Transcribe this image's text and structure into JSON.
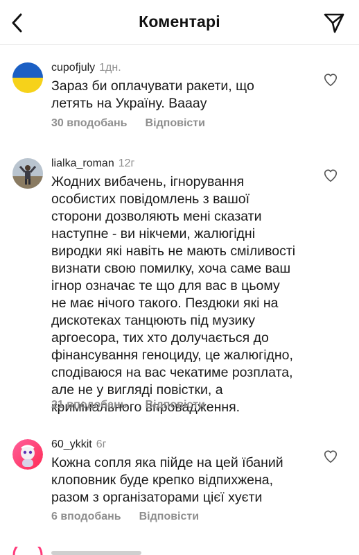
{
  "header": {
    "title": "Коментарі",
    "back_icon": "chevron-left-icon",
    "share_icon": "paper-plane-icon"
  },
  "comments": [
    {
      "username": "cupofjuly",
      "time": "1дн.",
      "text": "Зараз би оплачувати ракети, що\nлетять на Україну. Ваааy",
      "likes": "30 вподобань",
      "reply": "Відповісти",
      "avatar": "ukraine-flag-avatar",
      "colors": {
        "top": "#1b5fc4",
        "bottom": "#f6d21a"
      }
    },
    {
      "username": "lialka_roman",
      "time": "12г",
      "text": "Жодних вибачень, ігнорування\nособистих повідомлень з вашої\nсторони дозволяють мені сказати\nнаступне - ви нікчеми, жалюгідні\nвиродки які навіть не мають сміливості\nвизнати свою помилку, хоча саме ваш\nігнор означає те що для вас в цьому\nне має нічого такого. Пездюки які на\nдискотеках танцюють під музику\nаргоесора, тих хто долучається до\nфінансування геноциду, це жалюгідно,\nсподіваюся на вас чекатиме розплата,\nале не у вигляді повістки, а\nкримінального впровадження.",
      "likes": "21 вподобань",
      "reply": "Відповісти",
      "avatar": "person-photo-avatar"
    },
    {
      "username": "60_ykkit",
      "time": "6г",
      "text": "Кожна сопля яка пійде на цей їбаний\nклоповник буде крепко відпиxжена,\nразом з організаторами цієї хуєти",
      "likes": "6 вподобань",
      "reply": "Відповісти",
      "avatar": "cartoon-avatar"
    }
  ],
  "heart_icon": "heart-outline-icon",
  "colors": {
    "secondary_text": "#8e8e8e",
    "divider": "#e6e6e6"
  }
}
